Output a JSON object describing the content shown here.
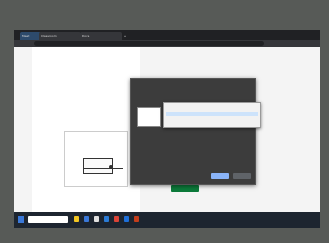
{
  "browser": {
    "tabs": [
      {
        "label": "Meet"
      },
      {
        "label": "Classroom"
      },
      {
        "label": "Docs"
      }
    ],
    "new_tab": "+"
  },
  "page": {
    "heading": "",
    "subtext": "",
    "gray_text": "",
    "right_text": ""
  },
  "share_dialog": {
    "title": "",
    "subtitle": "",
    "tabs": [
      {
        "label": ""
      },
      {
        "label": ""
      },
      {
        "label": ""
      }
    ],
    "option": "",
    "share_button": "",
    "cancel_button": ""
  },
  "popup": {
    "header": "",
    "rows": [
      {
        "label": ""
      },
      {
        "label": ""
      }
    ]
  },
  "taskbar": {
    "search_placeholder": "",
    "clock": ""
  },
  "colors": {
    "accent": "#8ab4f8",
    "green_button": "#0c7a3a",
    "taskbar": "#1d2530"
  }
}
